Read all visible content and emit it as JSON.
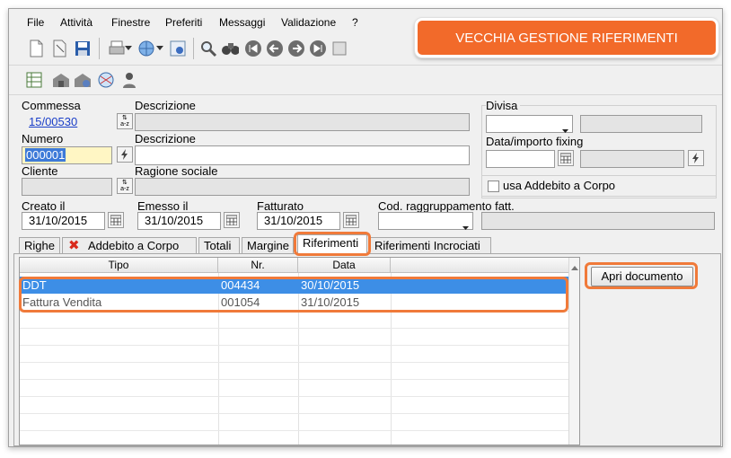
{
  "menu": {
    "file": "File",
    "attivita": "Attività",
    "finestre": "Finestre",
    "preferiti": "Preferiti",
    "messaggi": "Messaggi",
    "validazione": "Validazione",
    "help": "?"
  },
  "banner": {
    "text": "VECCHIA GESTIONE RIFERIMENTI"
  },
  "form": {
    "commessa_label": "Commessa",
    "commessa_value": "15/00530",
    "descrizione_label": "Descrizione",
    "numero_label": "Numero",
    "numero_value": "000001",
    "descrizione2_label": "Descrizione",
    "cliente_label": "Cliente",
    "ragione_sociale_label": "Ragione sociale",
    "divisa_label": "Divisa",
    "fixing_label": "Data/importo fixing",
    "addebito_checkbox_label": "usa Addebito a Corpo",
    "creato_label": "Creato il",
    "creato_value": "31/10/2015",
    "emesso_label": "Emesso il",
    "emesso_value": "31/10/2015",
    "fatturato_label": "Fatturato",
    "fatturato_value": "31/10/2015",
    "cod_raggr_label": "Cod. raggruppamento fatt."
  },
  "tabs": {
    "righe": "Righe",
    "addebito": "Addebito a Corpo",
    "totali": "Totali",
    "margine": "Margine",
    "riferimenti": "Riferimenti",
    "incrociati": "Riferimenti Incrociati"
  },
  "grid": {
    "columns": {
      "tipo": "Tipo",
      "nr": "Nr.",
      "data": "Data"
    },
    "rows": [
      {
        "tipo": "DDT",
        "nr": "004434",
        "data": "30/10/2015"
      },
      {
        "tipo": "Fattura Vendita",
        "nr": "001054",
        "data": "31/10/2015"
      }
    ]
  },
  "actions": {
    "apri_documento": "Apri documento"
  },
  "colors": {
    "accent_orange": "#f26a2a",
    "selection_blue": "#3d8ee6"
  }
}
